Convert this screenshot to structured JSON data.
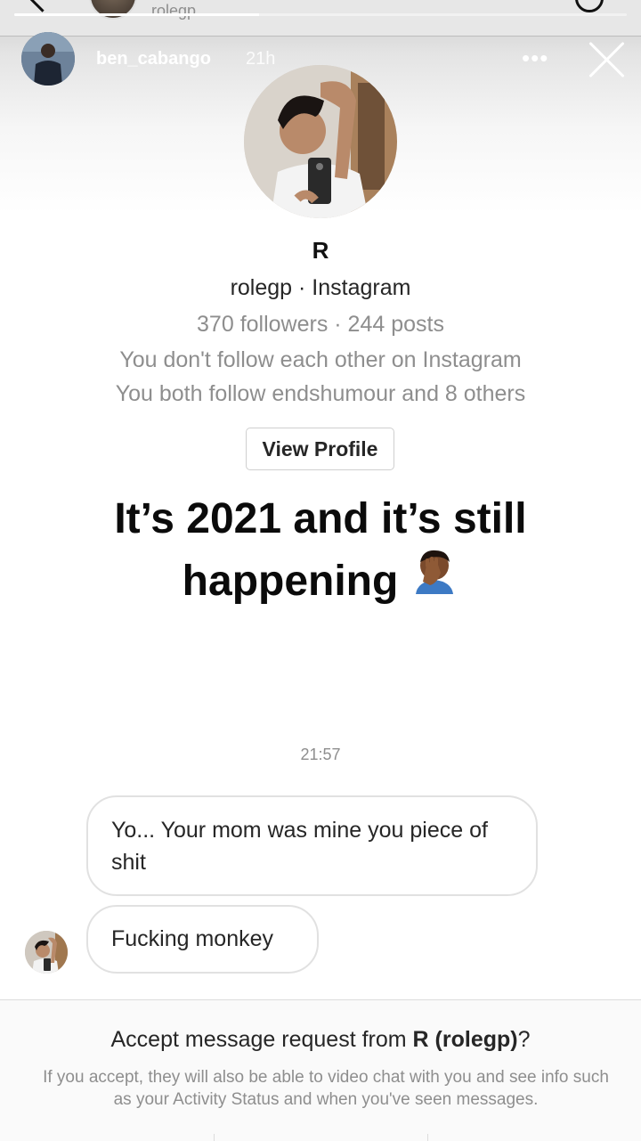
{
  "story": {
    "username": "ben_cabango",
    "time_ago": "21h",
    "more_label": "•••",
    "progress_fraction": 0.4
  },
  "background_chat": {
    "username": "rolegp"
  },
  "profile_card": {
    "name": "R",
    "handle_line": "rolegp · Instagram",
    "stats_line": "370 followers · 244 posts",
    "mutual_line_1": "You don't follow each other on Instagram",
    "mutual_line_2": "You both follow endshumour and 8 others",
    "view_profile_label": "View Profile"
  },
  "caption": {
    "line1": "It’s 2021 and it’s still",
    "line2": "happening",
    "emoji_icon": "face-palm-emoji"
  },
  "conversation": {
    "timestamp": "21:57",
    "messages": [
      {
        "text": "Yo... Your mom was mine you piece of shit"
      },
      {
        "text": "Fucking monkey"
      }
    ]
  },
  "message_request": {
    "title_prefix": "Accept message request from ",
    "title_bold": "R (rolegp)",
    "title_suffix": "?",
    "note": "If you accept, they will also be able to video chat with you and see info such as your Activity Status and when you've seen messages."
  }
}
